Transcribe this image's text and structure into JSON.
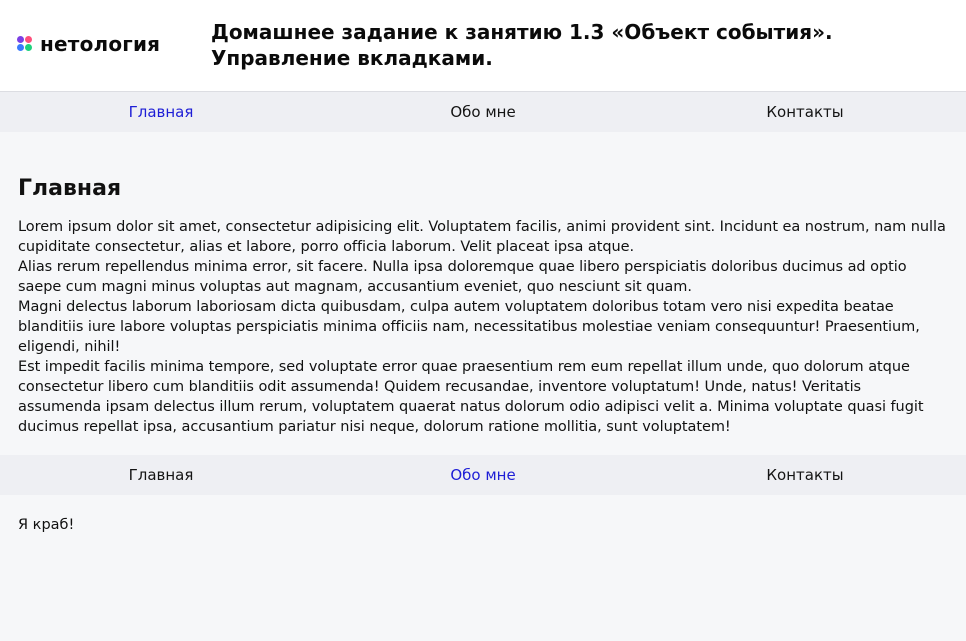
{
  "colors": {
    "accent_link": "#1e1ed6",
    "nav_background": "#eeeff3",
    "page_background": "#f6f7f9",
    "logo_dots": [
      "#7b3fe4",
      "#ff4f7b",
      "#3a7bfd",
      "#1fd17c"
    ]
  },
  "header": {
    "logo_icon": "netology-dots-logo-icon",
    "logo_text": "нетология",
    "title": "Домашнее задание к занятию 1.3 «Объект события». Управление вкладками."
  },
  "nav1": {
    "items": [
      {
        "label": "Главная",
        "active": true
      },
      {
        "label": "Обо мне",
        "active": false
      },
      {
        "label": "Контакты",
        "active": false
      }
    ]
  },
  "main_section": {
    "title": "Главная",
    "paragraphs": [
      "Lorem ipsum dolor sit amet, consectetur adipisicing elit. Voluptatem facilis, animi provident sint. Incidunt ea nostrum, nam nulla cupiditate consectetur, alias et labore, porro officia laborum. Velit placeat ipsa atque.",
      "Alias rerum repellendus minima error, sit facere. Nulla ipsa doloremque quae libero perspiciatis doloribus ducimus ad optio saepe cum magni minus voluptas aut magnam, accusantium eveniet, quo nesciunt sit quam.",
      "Magni delectus laborum laboriosam dicta quibusdam, culpa autem voluptatem doloribus totam vero nisi expedita beatae blanditiis iure labore voluptas perspiciatis minima officiis nam, necessitatibus molestiae veniam consequuntur! Praesentium, eligendi, nihil!",
      "Est impedit facilis minima tempore, sed voluptate error quae praesentium rem eum repellat illum unde, quo dolorum atque consectetur libero cum blanditiis odit assumenda! Quidem recusandae, inventore voluptatum! Unde, natus! Veritatis assumenda ipsam delectus illum rerum, voluptatem quaerat natus dolorum odio adipisci velit a. Minima voluptate quasi fugit ducimus repellat ipsa, accusantium pariatur nisi neque, dolorum ratione mollitia, sunt voluptatem!"
    ]
  },
  "nav2": {
    "items": [
      {
        "label": "Главная",
        "active": false
      },
      {
        "label": "Обо мне",
        "active": true
      },
      {
        "label": "Контакты",
        "active": false
      }
    ]
  },
  "about_section": {
    "text": "Я краб!"
  }
}
